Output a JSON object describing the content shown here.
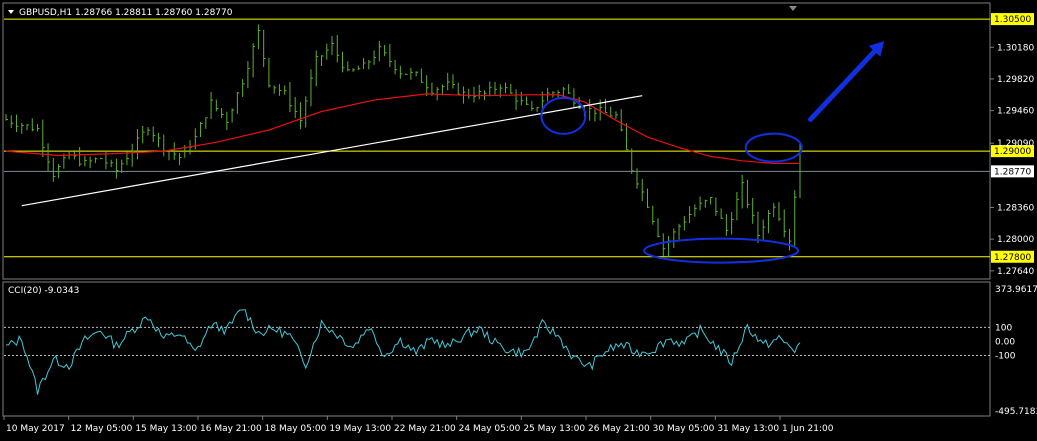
{
  "chart_data": [
    {
      "type": "line",
      "header": "GBPUSD,H1  1.28766 1.28811 1.28760 1.28770",
      "symbol": "GBPUSD",
      "timeframe": "H1",
      "last_ohlc": {
        "open": 1.28766,
        "high": 1.28811,
        "low": 1.2876,
        "close": 1.2877
      },
      "ylim": [
        1.2757,
        1.3066
      ],
      "y_ticks": [
        "1.30180",
        "1.29820",
        "1.29460",
        "1.29090",
        "1.28360",
        "1.28000",
        "1.27640"
      ],
      "x_ticks": [
        "10 May 2017",
        "12 May 05:00",
        "15 May 13:00",
        "16 May 21:00",
        "18 May 05:00",
        "19 May 13:00",
        "22 May 21:00",
        "24 May 05:00",
        "25 May 13:00",
        "26 May 21:00",
        "30 May 05:00",
        "31 May 13:00",
        "1 Jun 21:00"
      ],
      "horizontal_levels": [
        {
          "label": "1.30500",
          "value": 1.305,
          "color": "#ffff00"
        },
        {
          "label": "1.29000",
          "value": 1.29,
          "color": "#ffff00"
        },
        {
          "label": "1.27800",
          "value": 1.278,
          "color": "#ffff00"
        }
      ],
      "current_price": {
        "label": "1.28770",
        "value": 1.2877
      },
      "series": [
        {
          "type": "bars",
          "color": "#5fb030",
          "x": [
            0,
            3,
            6,
            9,
            12,
            15,
            18,
            21,
            24,
            27,
            30,
            33,
            36,
            39,
            42,
            45,
            48,
            50,
            53,
            56,
            59,
            62,
            65,
            68,
            71,
            75,
            78,
            81,
            84,
            87,
            91,
            94,
            97,
            100,
            103,
            106,
            110,
            113,
            116,
            119,
            122,
            125,
            128,
            131,
            134,
            137,
            140,
            143,
            146,
            149,
            151
          ],
          "values": [
            1.2936,
            1.293,
            1.2925,
            1.2874,
            1.2895,
            1.2886,
            1.2892,
            1.2878,
            1.2902,
            1.2928,
            1.2905,
            1.2893,
            1.2915,
            1.2955,
            1.2935,
            1.298,
            1.3035,
            1.2978,
            1.2965,
            1.2935,
            1.3003,
            1.302,
            1.2988,
            1.2996,
            1.3015,
            1.299,
            1.2986,
            1.297,
            1.2975,
            1.2965,
            1.2965,
            1.2975,
            1.296,
            1.2945,
            1.2965,
            1.297,
            1.2948,
            1.2945,
            1.294,
            1.288,
            1.284,
            1.279,
            1.2815,
            1.2835,
            1.2845,
            1.281,
            1.286,
            1.2805,
            1.284,
            1.28,
            1.29
          ]
        },
        {
          "type": "line",
          "color": "#e81010",
          "x": [
            0,
            10,
            20,
            30,
            40,
            50,
            60,
            70,
            80,
            90,
            100,
            105,
            110,
            116,
            122,
            128,
            134,
            140,
            146,
            151
          ],
          "values": [
            1.29,
            1.2895,
            1.2897,
            1.29,
            1.291,
            1.2924,
            1.2945,
            1.2958,
            1.2965,
            1.2963,
            1.2964,
            1.2964,
            1.2956,
            1.2935,
            1.2916,
            1.2904,
            1.2894,
            1.2889,
            1.2886,
            1.2886
          ]
        }
      ],
      "trendline": {
        "color": "#ffffff",
        "x": [
          3,
          121
        ],
        "values": [
          1.2838,
          1.2963
        ]
      },
      "ellipses": [
        {
          "x": 106,
          "y": 1.294,
          "color": "#1030e0"
        },
        {
          "x": 136,
          "y": 1.2787,
          "color": "#1030e0"
        },
        {
          "x": 146,
          "y": 1.2904,
          "color": "#1030e0"
        }
      ],
      "arrow": {
        "from": [
          153,
          1.2936
        ],
        "to": [
          167,
          1.3025
        ],
        "color": "#1030e0",
        "direction": "up-right"
      }
    },
    {
      "type": "line",
      "header": "CCI(20) -9.0343",
      "name": "CCI(20)",
      "value": -9.0343,
      "ylim": [
        -495.7183,
        373.9617
      ],
      "y_ticks": [
        "373.9617",
        "100",
        "0.00",
        "-100",
        "-495.7183"
      ],
      "levels": [
        100,
        -100
      ],
      "series": [
        {
          "color": "#40c8d8",
          "x": [
            0,
            3,
            6,
            9,
            12,
            15,
            18,
            21,
            24,
            27,
            30,
            33,
            36,
            39,
            42,
            45,
            48,
            51,
            54,
            57,
            60,
            63,
            66,
            69,
            72,
            75,
            78,
            81,
            84,
            87,
            90,
            93,
            96,
            99,
            102,
            105,
            108,
            111,
            114,
            117,
            120,
            123,
            126,
            129,
            132,
            135,
            138,
            141,
            144,
            147,
            150,
            151
          ],
          "values": [
            -40,
            20,
            -350,
            -130,
            -170,
            10,
            80,
            -30,
            80,
            180,
            20,
            60,
            -80,
            120,
            80,
            240,
            60,
            90,
            40,
            -160,
            130,
            50,
            -40,
            110,
            -100,
            10,
            -80,
            20,
            -40,
            40,
            90,
            -10,
            -70,
            -80,
            120,
            40,
            -120,
            -180,
            -70,
            -20,
            -80,
            -60,
            20,
            -20,
            80,
            -30,
            -150,
            110,
            -30,
            20,
            -60,
            -9
          ]
        }
      ]
    }
  ]
}
